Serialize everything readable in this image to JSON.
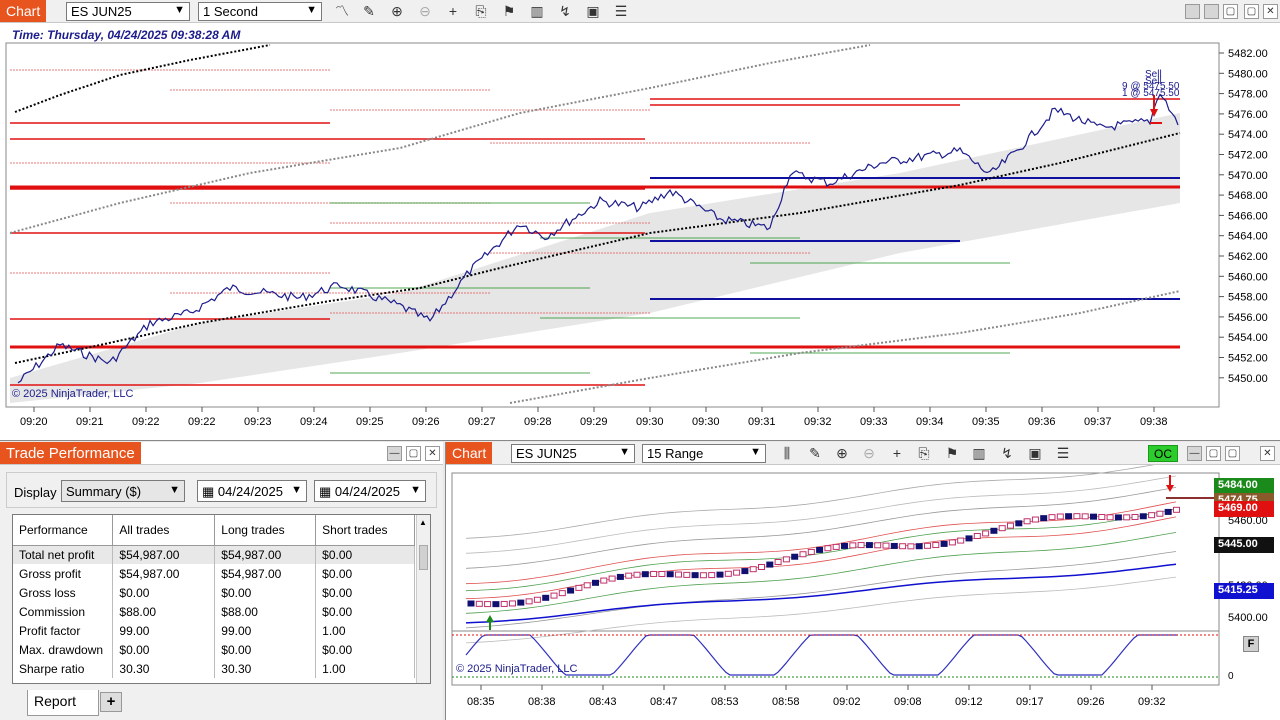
{
  "top_chart": {
    "tab_label": "Chart",
    "instrument": "ES JUN25",
    "interval": "1 Second",
    "time_label": "Time: Thursday, 04/24/2025 09:38:28 AM",
    "copyright": "© 2025 NinjaTrader, LLC",
    "annotation_sell_1": "Sell",
    "annotation_sell_2": "Sell",
    "annotation_fill_1": "9 @ 5475.50",
    "annotation_fill_2": "1 @ 5475.50",
    "y_ticks": [
      "5482.00",
      "5480.00",
      "5478.00",
      "5476.00",
      "5474.00",
      "5472.00",
      "5470.00",
      "5468.00",
      "5466.00",
      "5464.00",
      "5462.00",
      "5460.00",
      "5458.00",
      "5456.00",
      "5454.00",
      "5452.00",
      "5450.00"
    ],
    "x_ticks": [
      "09:20",
      "09:21",
      "09:22",
      "09:22",
      "09:23",
      "09:24",
      "09:25",
      "09:26",
      "09:27",
      "09:28",
      "09:29",
      "09:30",
      "09:30",
      "09:31",
      "09:32",
      "09:33",
      "09:34",
      "09:35",
      "09:36",
      "09:37",
      "09:38"
    ]
  },
  "performance": {
    "tab_label": "Trade Performance",
    "display_label": "Display",
    "display_value": "Summary ($)",
    "date_from": "04/24/2025",
    "date_to": "04/24/2025",
    "columns": [
      "Performance",
      "All trades",
      "Long trades",
      "Short trades"
    ],
    "rows": [
      [
        "Total net profit",
        "$54,987.00",
        "$54,987.00",
        "$0.00"
      ],
      [
        "Gross profit",
        "$54,987.00",
        "$54,987.00",
        "$0.00"
      ],
      [
        "Gross loss",
        "$0.00",
        "$0.00",
        "$0.00"
      ],
      [
        "Commission",
        "$88.00",
        "$88.00",
        "$0.00"
      ],
      [
        "Profit factor",
        "99.00",
        "99.00",
        "1.00"
      ],
      [
        "Max. drawdown",
        "$0.00",
        "$0.00",
        "$0.00"
      ],
      [
        "Sharpe ratio",
        "30.30",
        "30.30",
        "1.00"
      ]
    ],
    "report_tab": "Report",
    "add_tab": "+"
  },
  "bottom_chart": {
    "tab_label": "Chart",
    "instrument": "ES JUN25",
    "interval": "15 Range",
    "oc_label": "OC",
    "copyright": "© 2025 NinjaTrader, LLC",
    "y_ticks": [
      "5480.00",
      "5460.00",
      "5430.00",
      "5400.00"
    ],
    "panel2_tick": "0",
    "tag_green": "5484.00",
    "tag_brown": "5474.75",
    "tag_red": "5469.00",
    "tag_black": "5445.00",
    "tag_blue": "5415.25",
    "x_ticks": [
      "08:35",
      "08:38",
      "08:43",
      "08:47",
      "08:53",
      "08:58",
      "09:02",
      "09:08",
      "09:12",
      "09:17",
      "09:26",
      "09:32"
    ],
    "indicator_btn": "F"
  },
  "colors": {
    "accent": "#e8541e",
    "price_line": "#1c1c8c",
    "sell": "#e01010",
    "buy": "#1a8a1a",
    "oc_green": "#2bcc2b"
  }
}
